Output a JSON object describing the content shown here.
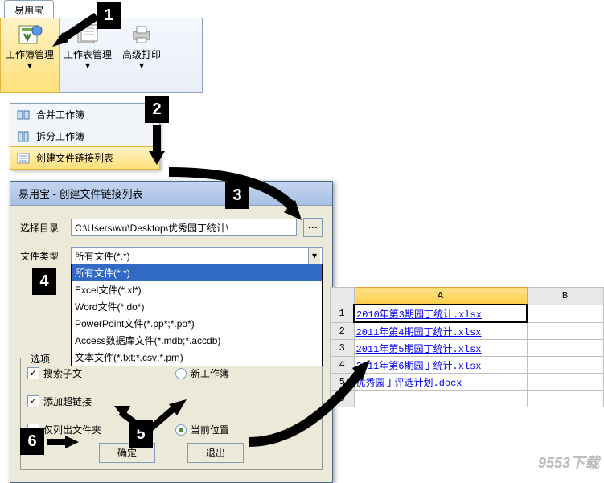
{
  "tab_label": "易用宝",
  "ribbon": {
    "b1": "工作簿管理",
    "b2": "工作表管理",
    "b3": "高级打印"
  },
  "menu": {
    "m1": "合并工作簿",
    "m2": "拆分工作簿",
    "m3": "创建文件链接列表"
  },
  "dialog": {
    "title": "易用宝 - 创建文件链接列表",
    "dir_label": "选择目录",
    "dir_value": "C:\\Users\\wu\\Desktop\\优秀园丁统计\\",
    "type_label": "文件类型",
    "type_value": "所有文件(*.*)",
    "options_legend": "选项",
    "opts": [
      "所有文件(*.*)",
      "Excel文件(*.xl*)",
      "Word文件(*.do*)",
      "PowerPoint文件(*.pp*;*.po*)",
      "Access数据库文件(*.mdb;*.accdb)",
      "文本文件(*.txt;*.csv;*.prn)"
    ],
    "chk1": "搜索子文",
    "chk2": "添加超链接",
    "chk3": "仅列出文件夹",
    "rad1": "新工作簿",
    "rad2": "当前位置",
    "ok": "确定",
    "cancel": "退出"
  },
  "sheet": {
    "colA": "A",
    "colB": "B",
    "rows": [
      "2010年第3期园丁统计.xlsx",
      "2011年第4期园丁统计.xlsx",
      "2011年第5期园丁统计.xlsx",
      "2011年第6期园丁统计.xlsx",
      "优秀园丁评选计划.docx"
    ]
  },
  "watermark": "9553下载"
}
